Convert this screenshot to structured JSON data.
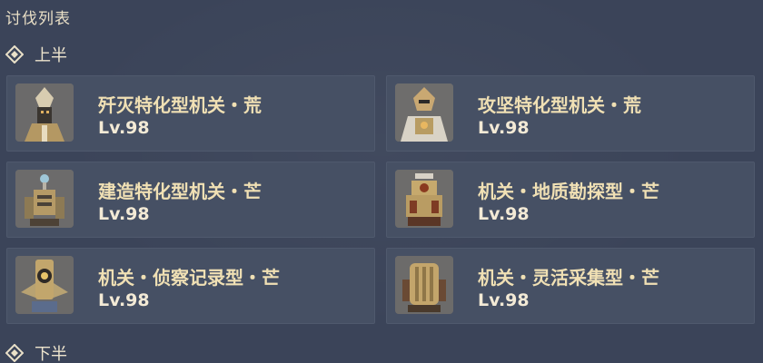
{
  "header": {
    "title": "讨伐列表"
  },
  "sections": [
    {
      "label": "上半"
    },
    {
      "label": "下半"
    }
  ],
  "enemies": [
    {
      "name": "歼灭特化型机关・荒",
      "level": "Lv.98"
    },
    {
      "name": "攻坚特化型机关・荒",
      "level": "Lv.98"
    },
    {
      "name": "建造特化型机关・芒",
      "level": "Lv.98"
    },
    {
      "name": "机关・地质勘探型・芒",
      "level": "Lv.98"
    },
    {
      "name": "机关・侦察记录型・芒",
      "level": "Lv.98"
    },
    {
      "name": "机关・灵活采集型・芒",
      "level": "Lv.98"
    }
  ]
}
